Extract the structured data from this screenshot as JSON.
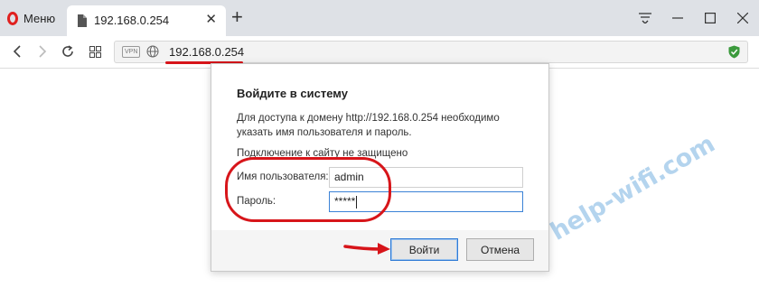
{
  "browser": {
    "menu_label": "Меню",
    "tab_title": "192.168.0.254",
    "new_tab_symbol": "+",
    "tab_close_symbol": "✕",
    "url": "192.168.0.254",
    "vpn_label": "VPN",
    "accent": "#e0201f"
  },
  "dialog": {
    "title": "Войдите в систему",
    "description": "Для доступа к домену http://192.168.0.254 необходимо указать имя пользователя и пароль.",
    "insecure_notice": "Подключение к сайту не защищено",
    "username_label": "Имя пользователя:",
    "username_value": "admin",
    "password_label": "Пароль:",
    "password_value": "*****",
    "login_button": "Войти",
    "cancel_button": "Отмена"
  },
  "watermark": "help-wifi.com",
  "annotation_color": "#d7151a"
}
